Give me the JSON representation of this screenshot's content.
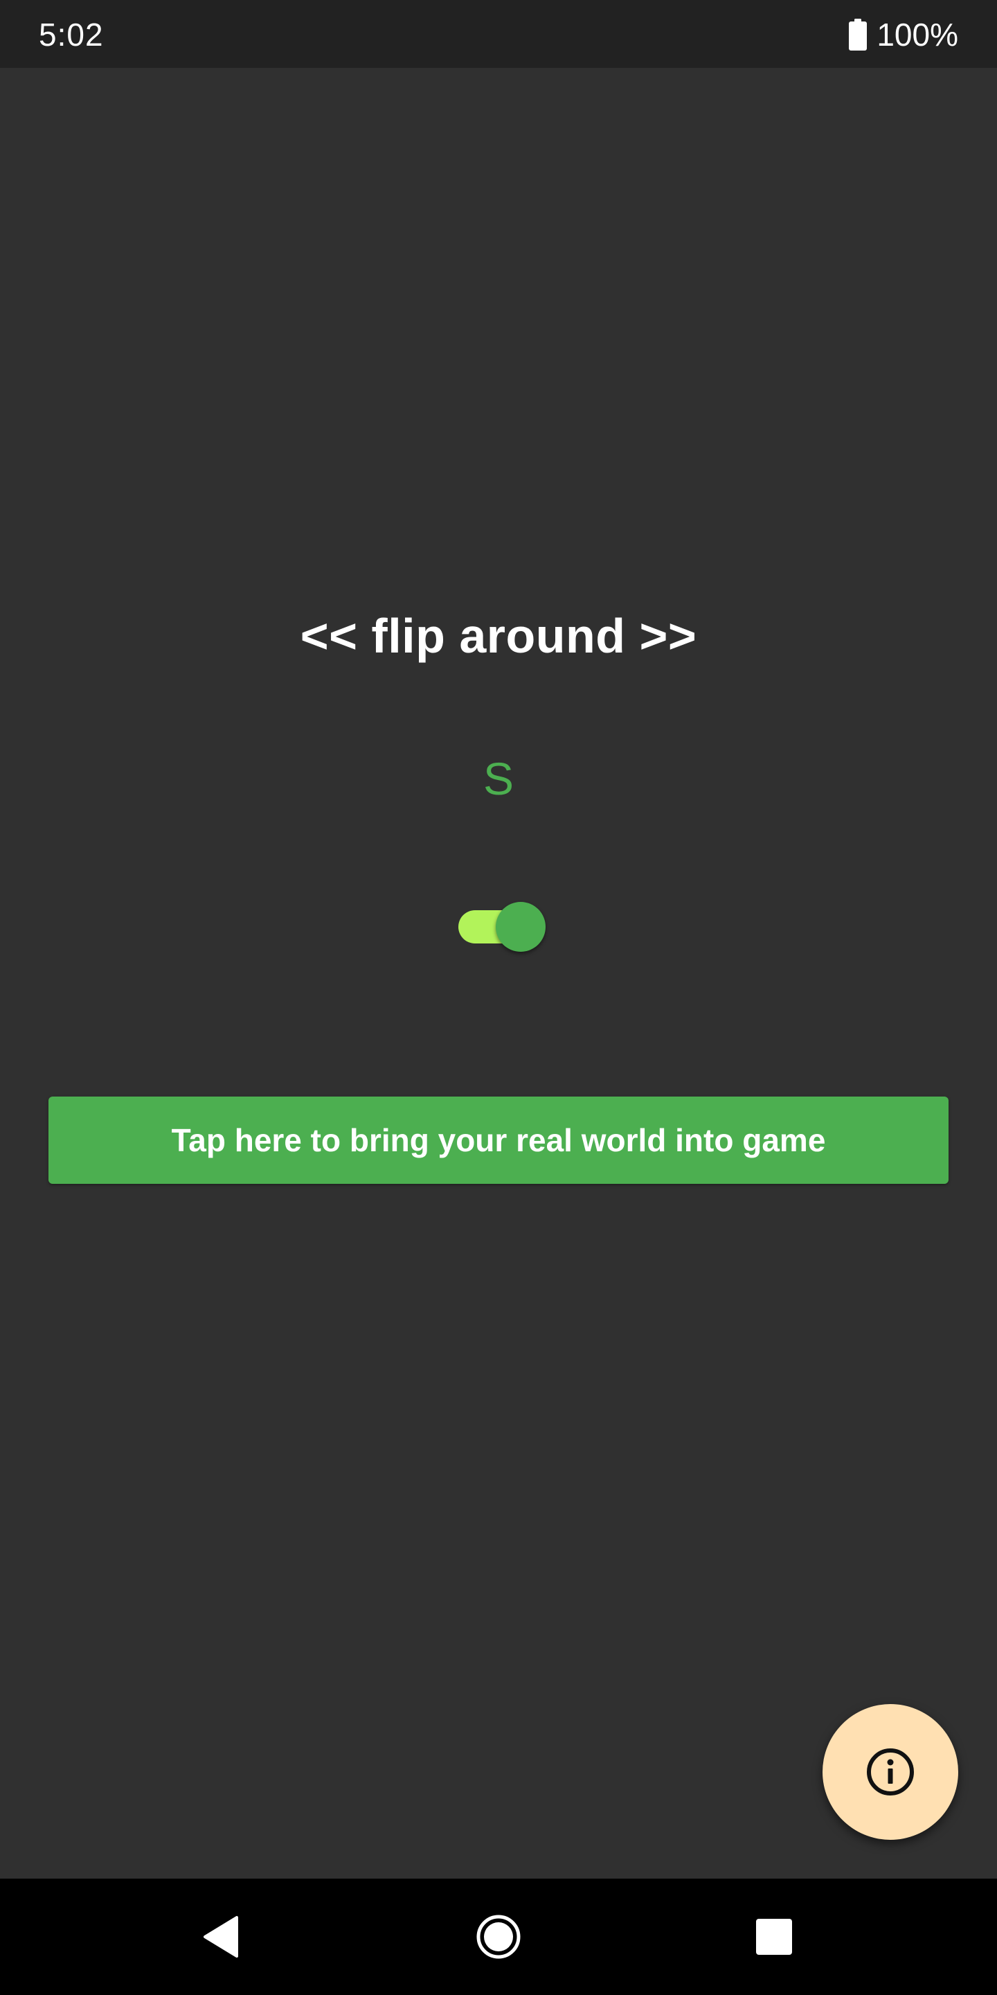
{
  "status_bar": {
    "time": "5:02",
    "battery_icon": "battery-full-icon",
    "battery_level": "100%"
  },
  "main": {
    "title": "<< flip around >>",
    "direction_letter": "S",
    "toggle": {
      "state": "on",
      "track_color": "#b2f35a",
      "thumb_color": "#4caf50"
    },
    "action_button_label": "Tap here to bring your real world into game",
    "action_button_color": "#4caf50"
  },
  "fab": {
    "icon": "info-icon",
    "color": "#ffe0b2"
  },
  "nav_bar": {
    "back_icon": "back-triangle-icon",
    "home_icon": "home-circle-icon",
    "recents_icon": "recents-square-icon"
  },
  "colors": {
    "background": "#303030",
    "status_bar": "#222222",
    "nav_bar": "#000000",
    "accent_green": "#4caf50"
  }
}
